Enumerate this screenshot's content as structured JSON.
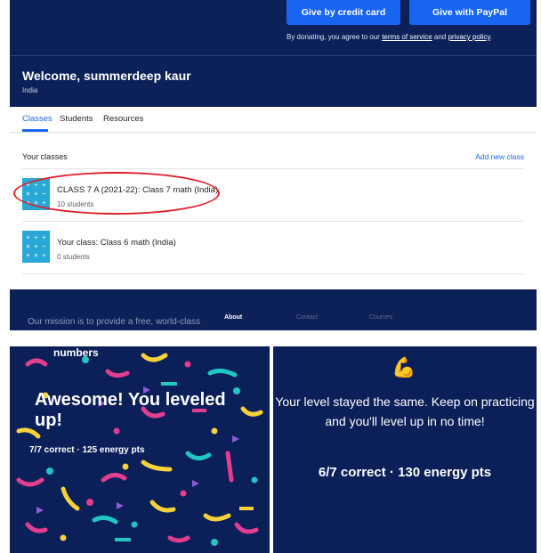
{
  "donate": {
    "card_label": "Give by credit card",
    "paypal_label": "Give with PayPal",
    "note_prefix": "By donating, you agree to our ",
    "terms_link": "terms of service",
    "note_and": " and ",
    "privacy_link": "privacy policy",
    "note_suffix": "."
  },
  "welcome": {
    "title": "Welcome, summerdeep kaur",
    "country": "India"
  },
  "tabs": [
    "Classes",
    "Students",
    "Resources"
  ],
  "classes": {
    "header": "Your classes",
    "add_label": "Add new class",
    "items": [
      {
        "name": "CLASS 7 A (2021-22): Class 7 math (India)",
        "count": "10 students"
      },
      {
        "name": "Your class: Class 6 math (India)",
        "count": "0 students"
      }
    ]
  },
  "footer": {
    "mission": "Our mission is to provide a free, world-class",
    "about": "About",
    "contact": "Contact",
    "courses": "Courses"
  },
  "confetti_panel": {
    "cut_text": "numbers",
    "headline": "Awesome! You leveled up!",
    "stats": "7/7 correct · 125 energy pts"
  },
  "level_panel": {
    "icon": "flexed-biceps-icon",
    "message": "Your level stayed the same. Keep on practicing and you'll level up in no time!",
    "stats": "6/7 correct · 130 energy pts"
  },
  "colors": {
    "navy": "#0b2157",
    "brand_blue": "#1865f2",
    "highlight_circle": "#e0202b"
  }
}
